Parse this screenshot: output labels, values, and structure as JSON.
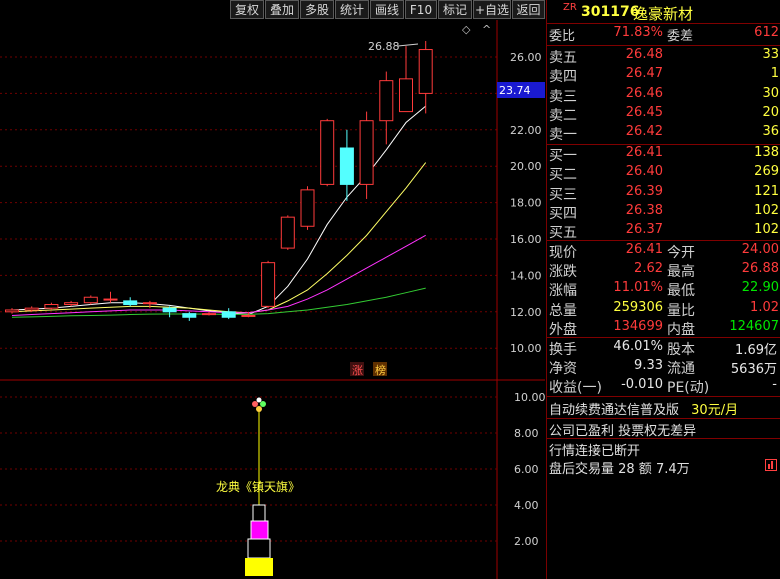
{
  "toolbar": {
    "buttons": [
      "复权",
      "叠加",
      "多股",
      "统计",
      "画线",
      "F10",
      "标记",
      "+自选",
      "返回"
    ]
  },
  "chart": {
    "price_axis": [
      "26.00",
      "24.00",
      "22.00",
      "20.00",
      "18.00",
      "16.00",
      "14.00",
      "12.00",
      "10.00"
    ],
    "current_price_tag": "23.74",
    "high_annotation": "26.88",
    "badges": [
      "涨",
      "榜"
    ],
    "indicator_axis": [
      "10.00",
      "8.00",
      "6.00",
      "4.00",
      "2.00"
    ],
    "indicator_label": "龙典《镇天旗》",
    "colors": {
      "up": "#ff3b3b",
      "down": "#54ffff",
      "ma_white": "#ffffff",
      "ma_yellow": "#ffff66",
      "ma_magenta": "#ff33ff",
      "ma_green": "#33cc33",
      "grid": "#800000",
      "indicator_magenta": "#ff00ff",
      "indicator_yellow": "#ffff00"
    }
  },
  "chart_data": {
    "type": "candlestick",
    "price_ticks": [
      10,
      12,
      14,
      16,
      18,
      20,
      22,
      24,
      26
    ],
    "candles": [
      {
        "o": 12.0,
        "c": 12.1,
        "h": 12.2,
        "l": 11.9
      },
      {
        "o": 12.1,
        "c": 12.2,
        "h": 12.3,
        "l": 12.0
      },
      {
        "o": 12.2,
        "c": 12.4,
        "h": 12.5,
        "l": 12.1
      },
      {
        "o": 12.4,
        "c": 12.5,
        "h": 12.6,
        "l": 12.3
      },
      {
        "o": 12.5,
        "c": 12.8,
        "h": 12.9,
        "l": 12.4
      },
      {
        "o": 12.7,
        "c": 12.7,
        "h": 13.1,
        "l": 12.5
      },
      {
        "o": 12.6,
        "c": 12.4,
        "h": 12.8,
        "l": 12.3
      },
      {
        "o": 12.5,
        "c": 12.5,
        "h": 12.6,
        "l": 12.2
      },
      {
        "o": 12.2,
        "c": 12.0,
        "h": 12.3,
        "l": 11.7
      },
      {
        "o": 11.9,
        "c": 11.7,
        "h": 12.0,
        "l": 11.5
      },
      {
        "o": 11.9,
        "c": 11.9,
        "h": 12.0,
        "l": 11.8
      },
      {
        "o": 12.0,
        "c": 11.7,
        "h": 12.2,
        "l": 11.6
      },
      {
        "o": 11.8,
        "c": 11.8,
        "h": 12.0,
        "l": 11.7
      },
      {
        "o": 12.3,
        "c": 14.7,
        "h": 14.8,
        "l": 12.2
      },
      {
        "o": 15.5,
        "c": 17.2,
        "h": 17.3,
        "l": 15.4
      },
      {
        "o": 16.7,
        "c": 18.7,
        "h": 18.9,
        "l": 16.5
      },
      {
        "o": 19.0,
        "c": 22.5,
        "h": 22.6,
        "l": 18.9
      },
      {
        "o": 21.0,
        "c": 19.0,
        "h": 22.0,
        "l": 18.1
      },
      {
        "o": 19.0,
        "c": 22.5,
        "h": 23.0,
        "l": 18.2
      },
      {
        "o": 22.5,
        "c": 24.7,
        "h": 25.2,
        "l": 21.2
      },
      {
        "o": 23.0,
        "c": 24.8,
        "h": 26.6,
        "l": 23.0
      },
      {
        "o": 24.0,
        "c": 26.41,
        "h": 26.88,
        "l": 22.9
      }
    ],
    "ma_white": [
      12.1,
      12.15,
      12.2,
      12.3,
      12.4,
      12.5,
      12.5,
      12.45,
      12.35,
      12.2,
      12.05,
      11.95,
      11.85,
      12.3,
      13.4,
      14.9,
      16.8,
      18.3,
      19.5,
      20.9,
      22.4,
      23.3
    ],
    "ma_yellow": [
      12.0,
      12.05,
      12.1,
      12.15,
      12.2,
      12.25,
      12.3,
      12.3,
      12.25,
      12.2,
      12.1,
      12.0,
      11.95,
      12.1,
      12.6,
      13.2,
      14.1,
      15.1,
      16.2,
      17.5,
      18.8,
      20.2
    ],
    "ma_magenta": [
      11.8,
      11.85,
      11.9,
      11.95,
      12.0,
      12.05,
      12.1,
      12.1,
      12.1,
      12.05,
      12.0,
      11.95,
      11.95,
      12.1,
      12.3,
      12.7,
      13.2,
      13.8,
      14.4,
      15.0,
      15.6,
      16.2
    ],
    "ma_green": [
      11.7,
      11.72,
      11.75,
      11.78,
      11.8,
      11.82,
      11.85,
      11.87,
      11.88,
      11.88,
      11.87,
      11.86,
      11.86,
      11.9,
      12.0,
      12.1,
      12.25,
      12.4,
      12.6,
      12.8,
      13.05,
      13.3
    ],
    "indicator_ticks": [
      2,
      4,
      6,
      8,
      10
    ]
  },
  "panel": {
    "code": "301176",
    "name": "逸豪新材",
    "tag": "ZR",
    "weibi_label": "委比",
    "weibi_value": "71.83%",
    "weicha_label": "委差",
    "weicha_value": "612",
    "sells": [
      {
        "label": "卖五",
        "price": "26.48",
        "vol": "33"
      },
      {
        "label": "卖四",
        "price": "26.47",
        "vol": "1"
      },
      {
        "label": "卖三",
        "price": "26.46",
        "vol": "30"
      },
      {
        "label": "卖二",
        "price": "26.45",
        "vol": "20"
      },
      {
        "label": "卖一",
        "price": "26.42",
        "vol": "36"
      }
    ],
    "buys": [
      {
        "label": "买一",
        "price": "26.41",
        "vol": "138"
      },
      {
        "label": "买二",
        "price": "26.40",
        "vol": "269"
      },
      {
        "label": "买三",
        "price": "26.39",
        "vol": "121"
      },
      {
        "label": "买四",
        "price": "26.38",
        "vol": "102"
      },
      {
        "label": "买五",
        "price": "26.37",
        "vol": "102"
      }
    ],
    "quote": [
      {
        "l1": "现价",
        "v1": "26.41",
        "c1": "red",
        "l2": "今开",
        "v2": "24.00",
        "c2": "red"
      },
      {
        "l1": "涨跌",
        "v1": "2.62",
        "c1": "red",
        "l2": "最高",
        "v2": "26.88",
        "c2": "red"
      },
      {
        "l1": "涨幅",
        "v1": "11.01%",
        "c1": "red",
        "l2": "最低",
        "v2": "22.90",
        "c2": "green"
      },
      {
        "l1": "总量",
        "v1": "259306",
        "c1": "yellow",
        "l2": "量比",
        "v2": "1.02",
        "c2": "red"
      },
      {
        "l1": "外盘",
        "v1": "134699",
        "c1": "red",
        "l2": "内盘",
        "v2": "124607",
        "c2": "green"
      }
    ],
    "fundamentals": [
      {
        "l1": "换手",
        "v1": "46.01%",
        "l2": "股本",
        "v2": "1.69亿"
      },
      {
        "l1": "净资",
        "v1": "9.33",
        "l2": "流通",
        "v2": "5636万"
      },
      {
        "l1": "收益(一)",
        "v1": "-0.010",
        "l2": "PE(动)",
        "v2": "-"
      }
    ],
    "promo_text": "自动续费通达信普及版",
    "promo_price": "30元/月",
    "notice_1": "公司已盈利 投票权无差异",
    "notice_2": "行情连接已断开",
    "after_hours": "盘后交易量 28 额 7.4万"
  }
}
